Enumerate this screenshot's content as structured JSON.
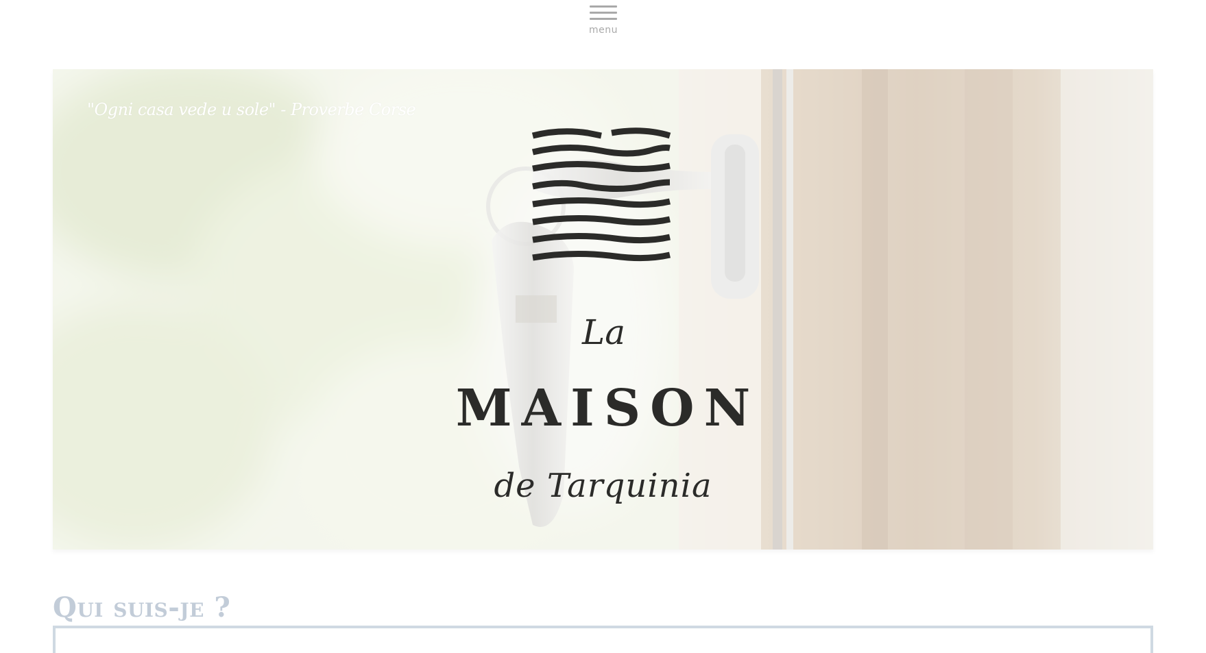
{
  "header": {
    "menu_label": "menu",
    "menu_icon": "hamburger-icon"
  },
  "hero": {
    "quote": "\"Ogni casa vede u sole\" - Proverbe Corse",
    "logo": {
      "line1": "La",
      "line2": "MAISON",
      "line3": "de Tarquinia",
      "icon": "waves-logo-icon"
    }
  },
  "section": {
    "title": "Qui suis-je ?"
  },
  "colors": {
    "menu_gray": "#a9a9a9",
    "logo_dark": "#2b2b29",
    "section_title": "#c2ccd8",
    "section_border": "#cfd9e2"
  }
}
